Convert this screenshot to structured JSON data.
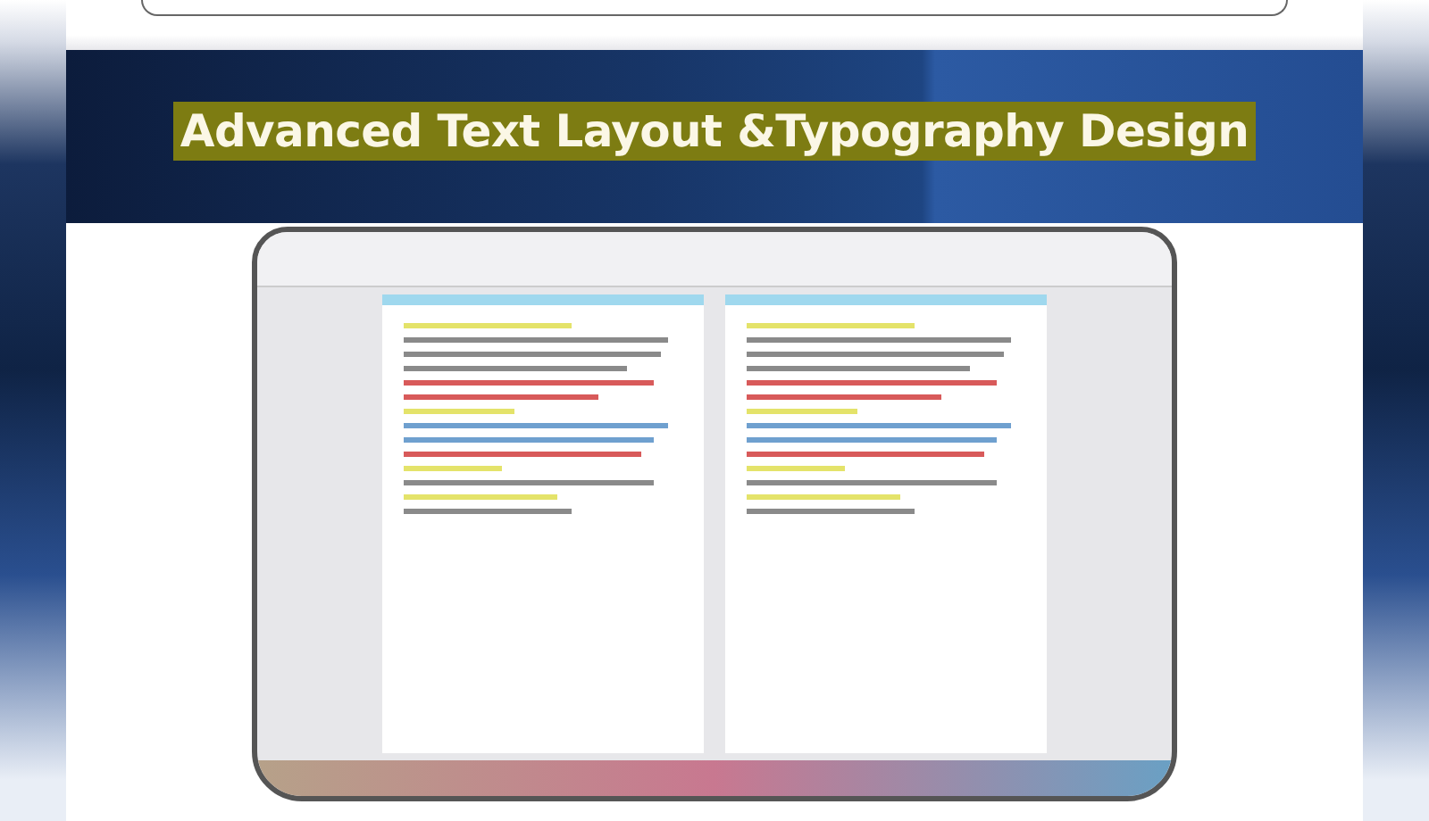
{
  "banner": {
    "title": "Advanced Text Layout &Typography Design"
  }
}
